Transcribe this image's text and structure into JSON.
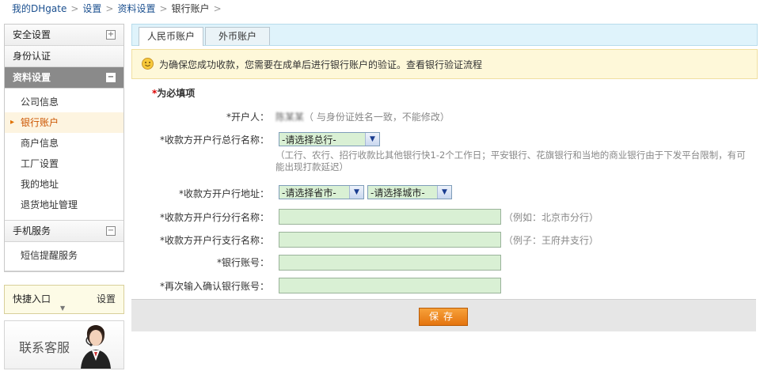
{
  "breadcrumb": [
    "我的DHgate",
    "设置",
    "资料设置",
    "银行账户"
  ],
  "sidebar": {
    "sections": [
      {
        "label": "安全设置",
        "toggle": "+"
      },
      {
        "label": "身份认证"
      },
      {
        "label": "资料设置",
        "toggle": "−",
        "items": [
          "公司信息",
          "银行账户",
          "商户信息",
          "工厂设置",
          "我的地址",
          "退货地址管理"
        ]
      },
      {
        "label": "手机服务",
        "toggle": "−",
        "items": [
          "短信提醒服务"
        ]
      }
    ],
    "quick": {
      "label": "快捷入口",
      "settings": "设置"
    },
    "service": "联系客服"
  },
  "tabs": [
    "人民币账户",
    "外币账户"
  ],
  "notice": {
    "text": "为确保您成功收款，您需要在成单后进行银行账户的验证。",
    "link": "查看银行验证流程"
  },
  "form": {
    "required_note": "*为必填项",
    "holder_label": "*开户人：",
    "holder_value": "陈某某",
    "holder_hint": "（ 与身份证姓名一致，不能修改）",
    "bank_label": "*收款方开户行总行名称：",
    "bank_select": "-请选择总行-",
    "bank_hint": "（工行、农行、招行收款比其他银行快1-2个工作日；平安银行、花旗银行和当地的商业银行由于下发平台限制，有可能出现打款延迟）",
    "address_label": "*收款方开户行地址：",
    "province_select": "-请选择省市-",
    "city_select": "-请选择城市-",
    "branch_label": "*收款方开户行分行名称：",
    "branch_hint": "（例如：北京市分行）",
    "subbranch_label": "*收款方开户行支行名称：",
    "subbranch_hint": "（例子：王府井支行）",
    "account_label": "*银行账号：",
    "confirm_label": "*再次输入确认银行账号：",
    "save_label": "保存"
  }
}
